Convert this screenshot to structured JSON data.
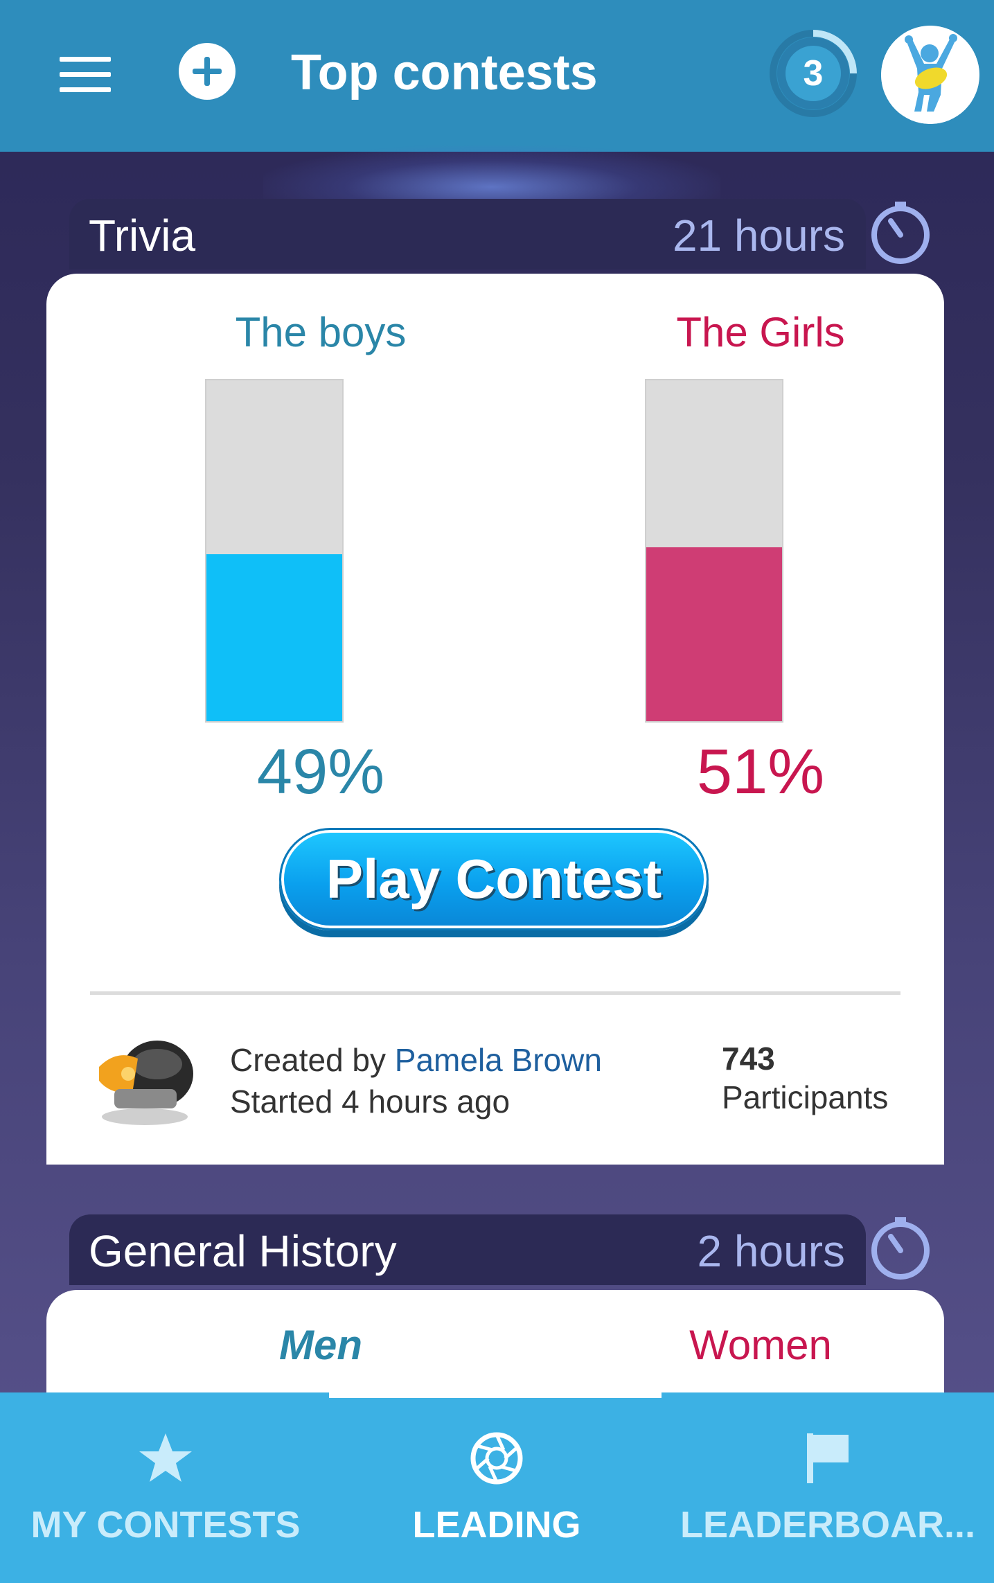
{
  "app_bar": {
    "title": "Top contests",
    "level": "3",
    "menu_icon": "hamburger-menu-icon",
    "add_icon": "plus-circle-icon",
    "avatar": "user-avatar"
  },
  "contests": [
    {
      "name": "Trivia",
      "time_left": "21 hours",
      "timer_icon": "stopwatch-icon",
      "team_a": {
        "label": "The boys",
        "percent": "49%",
        "fill": 0.49,
        "color": "#0fbff8"
      },
      "team_b": {
        "label": "The Girls",
        "percent": "51%",
        "fill": 0.51,
        "color": "#cf3d74"
      },
      "play_label": "Play Contest",
      "created_prefix": "Created by ",
      "creator": "Pamela Brown",
      "started": "Started 4 hours ago",
      "participants_count": "743",
      "participants_label": "Participants"
    },
    {
      "name": "General History",
      "time_left": "2 hours",
      "timer_icon": "stopwatch-icon",
      "team_a": {
        "label": "Men"
      },
      "team_b": {
        "label": "Women"
      }
    }
  ],
  "bottom_nav": {
    "items": [
      {
        "label": "MY CONTESTS",
        "icon": "star-icon",
        "active": false
      },
      {
        "label": "LEADING",
        "icon": "camera-shutter-icon",
        "active": true
      },
      {
        "label": "LEADERBOAR...",
        "icon": "flag-icon",
        "active": false
      }
    ]
  },
  "colors": {
    "appbar": "#2e8dbc",
    "nav": "#3cb1e4",
    "boys": "#2a86a8",
    "girls": "#c8164f"
  }
}
